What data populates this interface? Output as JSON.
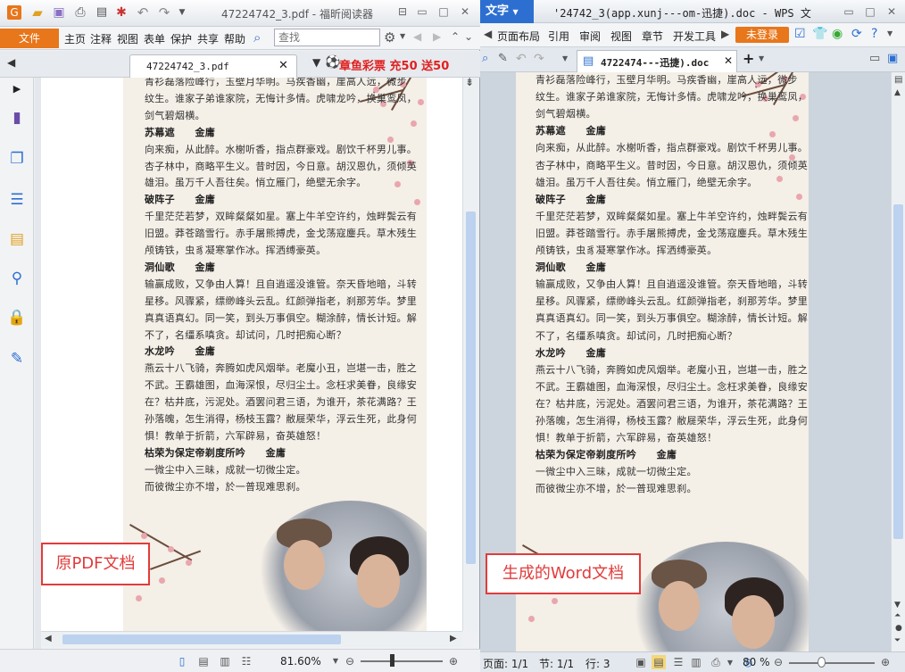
{
  "left_app": {
    "title": "47224742_3.pdf - 福昕阅读器",
    "file_menu": "文件",
    "menu": [
      "主页",
      "注释",
      "视图",
      "表单",
      "保护",
      "共享",
      "帮助"
    ],
    "search_placeholder": "查找",
    "tab_label": "47224742_3.pdf",
    "promo": "章鱼彩票 充50 送50",
    "zoom": "81.60%",
    "overlay_label": "原PDF文档"
  },
  "right_app": {
    "app_menu": "文字",
    "title": "'24742_3(app.xunj---om-迅捷).doc - WPS 文",
    "menu": [
      "页面布局",
      "引用",
      "审阅",
      "视图",
      "章节",
      "开发工具"
    ],
    "login": "未登录",
    "tab_label": "4722474---迅捷).doc",
    "status_page": "页面: 1/1",
    "status_section": "节: 1/1",
    "status_line": "行: 3",
    "zoom": "80 %",
    "overlay_label": "生成的Word文档"
  },
  "document": {
    "lines": [
      {
        "text": "青衫磊落险峰行，玉壁月华明。马疾香幽，崖高人远，微步",
        "heading": false
      },
      {
        "text": "纹生。谁家子弟谁家院，无悔计多情。虎啸龙吟，换巢鸾凤，",
        "heading": false
      },
      {
        "text": "剑气碧烟横。",
        "heading": false
      },
      {
        "text": "苏幕遮　　金庸",
        "heading": true
      },
      {
        "text": "向来痴，从此醉。水榭听香，指点群豪戏。剧饮千杯男儿事。",
        "heading": false
      },
      {
        "text": "杏子林中，商略平生义。昔时因，今日意。胡汉恩仇，须倾英",
        "heading": false
      },
      {
        "text": "雄泪。虽万千人吾往矣。悄立雁门，绝壁无余字。",
        "heading": false
      },
      {
        "text": "破阵子　　金庸",
        "heading": true
      },
      {
        "text": "千里茫茫若梦，双眸粲粲如星。塞上牛羊空许约，烛畔鬓云有",
        "heading": false
      },
      {
        "text": "旧盟。莽苍踏雪行。赤手屠熊搏虎，金戈荡寇鏖兵。草木残生",
        "heading": false
      },
      {
        "text": "颅铸铁，虫豸凝寒掌作冰。挥洒缚豪英。",
        "heading": false
      },
      {
        "text": "洞仙歌　　金庸",
        "heading": true
      },
      {
        "text": "输赢成败，又争由人算！且自逍遥没谁管。奈天昏地暗，斗转",
        "heading": false
      },
      {
        "text": "星移。风骤紧，缥缈峰头云乱。红颜弹指老，刹那芳华。梦里",
        "heading": false
      },
      {
        "text": "真真语真幻。同一笑，到头万事俱空。糊涂醉，情长计短。解",
        "heading": false
      },
      {
        "text": "不了，名缰系嗔贪。却试问，几时把痴心断？",
        "heading": false
      },
      {
        "text": "水龙吟　　金庸",
        "heading": true
      },
      {
        "text": "燕云十八飞骑，奔腾如虎风烟举。老魔小丑，岂堪一击，胜之",
        "heading": false
      },
      {
        "text": "不武。王霸雄图，血海深恨，尽归尘土。念枉求美眷，良缘安",
        "heading": false
      },
      {
        "text": "在？枯井底，污泥处。酒罢问君三语，为谁开，茶花满路？王",
        "heading": false
      },
      {
        "text": "孙落魄，怎生消得，杨枝玉露？敝屣荣华，浮云生死，此身何",
        "heading": false
      },
      {
        "text": "惧！教单于折箭，六军辟易，奋英雄怒！",
        "heading": false
      },
      {
        "text": "枯荣为保定帝剃度所吟　　金庸",
        "heading": true
      },
      {
        "text": "一微尘中入三昧，成就一切微尘定。",
        "heading": false
      },
      {
        "text": "而彼微尘亦不增，於一普现难思刹。",
        "heading": false
      }
    ]
  },
  "colors": {
    "accent_orange": "#e8761a",
    "label_red": "#e23b3b",
    "wps_blue": "#2d6fd1",
    "page_bg": "#f4efe7"
  }
}
